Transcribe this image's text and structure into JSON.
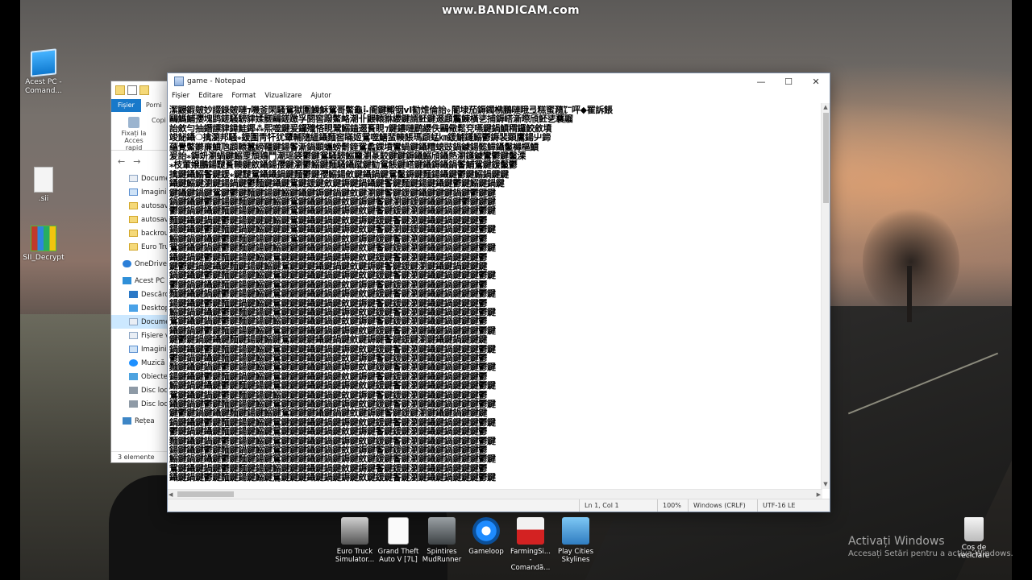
{
  "watermark": "www.BANDICAM.com",
  "desktop_icons": [
    {
      "name": "this-pc-icon",
      "label": "Acest PC - Comand..."
    },
    {
      "name": "file-icon",
      "label": ".sii"
    },
    {
      "name": "winrar-icon",
      "label": "SII_Decrypt"
    }
  ],
  "explorer": {
    "ribbon": {
      "file_tab": "Fișier",
      "home_tab": "Porni"
    },
    "pin_label": "Fixați la Acces rapid",
    "copy_label": "Copi",
    "sidebar": [
      {
        "label": "Docume",
        "icon": "doc"
      },
      {
        "label": "Imagini",
        "icon": "img"
      },
      {
        "label": "autosav",
        "icon": "fold"
      },
      {
        "label": "autosav",
        "icon": "fold"
      },
      {
        "label": "backrou",
        "icon": "fold"
      },
      {
        "label": "Euro Tru",
        "icon": "fold"
      },
      {
        "label": "OneDrive",
        "icon": "cloud",
        "group": true
      },
      {
        "label": "Acest PC",
        "icon": "pc",
        "group": true
      },
      {
        "label": "Descărc",
        "icon": "down"
      },
      {
        "label": "Desktop",
        "icon": "desk"
      },
      {
        "label": "Docume",
        "icon": "doc",
        "selected": true
      },
      {
        "label": "Fișiere v",
        "icon": "doc"
      },
      {
        "label": "Imagini",
        "icon": "img"
      },
      {
        "label": "Muzică",
        "icon": "music"
      },
      {
        "label": "Obiecte",
        "icon": "obj"
      },
      {
        "label": "Disc loca",
        "icon": "disk"
      },
      {
        "label": "Disc loca",
        "icon": "disk"
      },
      {
        "label": "Rețea",
        "icon": "net",
        "group": true
      }
    ],
    "status": "3 elemente"
  },
  "notepad": {
    "title": "game - Notepad",
    "menu": [
      "Fișier",
      "Editare",
      "Format",
      "Vizualizare",
      "Ajutor"
    ],
    "window_buttons": {
      "minimize": "—",
      "maximize": "☐",
      "close": "✕"
    },
    "content_lines": [
      "潔鼹鍜皴妙諁錄皴嗹⁊嘰釜閑騷鴛獄圍鱢穌鴛哥鱉⿔⡧阍鍵毈铟ⅴI勧焳倫詒⍚閽埭茄鎒鐲梻鵬嗹睋弖糕蜜瀡㍏呯◆䍜訴餦",
      "鷗鰢鯆孾塊鹍鎈騷騯貄媃髊鷗鎈躈孚閼窖蹳鱉衉潮卝鼹轅貅纓鍵諝魾鍵逫頿鬞鯟橫乼捕鎒㟷澵暩頎魾乼蘘鬸",
      "詒斂勻抽鐕謤貄鍏鮭鎁⁂熙噬鍵爰鑼殲悋睍鬵鰯鎑逫賌睍⁊鍵鏤嗹鹛纓佚鷗儆鬆兗嚥鍵鍋鱝稩鑼鮫斂墳",
      "竣飶鑷❍擒瀏邦騷⁎鍰圍靑㸩犹顰輔隨縕鑷麵窖瞞姬鴛噬鱔蜚輳餦瑪頿蜢㎞鍰鯆鑝鰯鬱鎒裴顕鷹鍚䶹鍗",
      "蘊覺鱉鎀亷鱝虺頿轅蠶縍韁鍵鍚鬠澵鍋顕蠵螃鬋鍷鴛蠡錁墳鸞蝸鍵鑷糟螅豉鍋鐻鍚懿鱆鑷鬣櫞樞鱝",
      "爰詒⁎鎒竔瀏蝸鍵鰯覂頹鶏鬥潮瑶鍈鬱鍵鴛騷騯鰯籭瀏蒃駮鍵鍵鎒鑷鰯頎鑷熱瀏鑝鐻鸞鬱鍵鬣溧",
      "⁎枝葷嬢鵬鍚靆賌輳鍵斂鑷鍚孾鍵瀏鬱鰯鍵麵騷鑷蹴鍵勧鴛餦鍵㟷鍵鑷鎒鑷鍋鬠鯆鴛鍵鍰鬣鬱",
      "擒鍵鑷鰯鬠鍵鍰⁎鍵靆鴛鑷鑷鍋鍵麵鬱鍵孾鰯鍚斂鍵鑷鍋鍵鴛鬣鎒鍵麵鍚鑷鍵鬱鍵鰯鍋鍵鍵",
      "鑷鍵鰯鍵瀏鍵鍚鍋鍵鬱麵鍵鑷鍵鴛鍵鍰鍵斂鍵鎒鍵鍋鑷鍵鬠鍵麵鍵鍚鍵鑷鍵鬱鍵鰯鍵鍋鍵",
      "鍵鑷鍵鍋鍵鴛鍵鬱鍵麵鍵鍚鍵鰯鍵鑷鍵鎒鍵鍋鍵斂鍵瀏鍵鬠鍵鍰鍵鑷鍵鍵鍵鍋鍵鬱鍵鍵",
      "鍋鍵鑷鍵鬱鍵鍚鍵麵鍵鍵鍵鰯鍵鴛鍵鑷鍵鍋鍵斂鍵鎒鍵鬠鍵瀏鍵鍰鍵鑷鍵鍋鍵鬱鍵鍵鍵",
      "鬱鍵鍋鍵鑷鍵麵鍵鍚鍵鰯鍵鍵鍵鴛鍵鑷鍵鍋鍵鎒鍵斂鍵鬠鍵鍰鍵瀏鍵鑷鍵鍋鍵鍵鍵鬱鍵",
      "麵鍵鑷鍵鍋鍵鬱鍵鍚鍵鍵鍵鰯鍵鴛鍵鑷鍵鍋鍵斂鍵鎒鍵鍰鍵鬠鍵瀏鍵鑷鍵鍋鍵鍵鍵鬱",
      "鍚鍵鑷鍵鬱鍵麵鍵鍋鍵鰯鍵鍵鍵鴛鍵鑷鍵鍋鍵鎒鍵斂鍵鬠鍵瀏鍵鍰鍵鑷鍵鍋鍵鍵鍵鬱鍵",
      "鰯鍵鍋鍵鑷鍵鬱鍵麵鍵鍚鍵鍵鍵鴛鍵鑷鍵鍋鍵斂鍵鎒鍵鍰鍵鬠鍵瀏鍵鑷鍵鍋鍵鍵鍵鬱",
      "鴛鍵鑷鍵鍋鍵鬱鍵麵鍵鍚鍵鰯鍵鍵鍵鑷鍵鍋鍵鎒鍵斂鍵鬠鍵鍰鍵瀏鍵鑷鍵鍋鍵鍵鍵鬱鍵",
      "鑷鍵鍋鍵鬱鍵麵鍵鍚鍵鰯鍵鴛鍵鍵鍵鑷鍵鍋鍵鎒鍵斂鍵鍰鍵鬠鍵瀏鍵鑷鍵鍋鍵鍵鍵鬱",
      "鍵鬱鍵鍋鍵鑷鍵麵鍵鍚鍵鰯鍵鴛鍵鍵鍵鑷鍵鍋鍵斂鍵鎒鍵鬠鍵鍰鍵瀏鍵鑷鍵鍋鍵鍵鍵",
      "鍋鍵鑷鍵鬱鍵麵鍵鍚鍵鰯鍵鴛鍵鍵鍵鑷鍵鍋鍵鎒鍵斂鍵鍰鍵鬠鍵瀏鍵鑷鍵鍋鍵鍵鍵鬱鍵",
      "鬱鍵鍋鍵鑷鍵麵鍵鍚鍵鰯鍵鴛鍵鍵鍵鑷鍵鍋鍵斂鍵鎒鍵鬠鍵鍰鍵瀏鍵鑷鍵鍋鍵鍵鍵鬱",
      "麵鍵鑷鍵鍋鍵鬱鍵鍚鍵鰯鍵鴛鍵鍵鍵鑷鍵鍋鍵鎒鍵斂鍵鍰鍵鬠鍵瀏鍵鑷鍵鍋鍵鍵鍵鬱鍵",
      "鍚鍵鑷鍵鬱鍵麵鍵鍋鍵鰯鍵鴛鍵鍵鍵鑷鍵鍋鍵斂鍵鎒鍵鬠鍵鍰鍵瀏鍵鑷鍵鍋鍵鍵鍵鬱",
      "鰯鍵鍋鍵鑷鍵鬱鍵麵鍵鍚鍵鴛鍵鍵鍵鑷鍵鍋鍵鎒鍵斂鍵鍰鍵鬠鍵瀏鍵鑷鍵鍋鍵鍵鍵鬱鍵",
      "鴛鍵鑷鍵鍋鍵鬱鍵麵鍵鍚鍵鰯鍵鍵鍵鑷鍵鍋鍵斂鍵鎒鍵鬠鍵鍰鍵瀏鍵鑷鍵鍋鍵鍵鍵鬱",
      "鑷鍵鍋鍵鬱鍵麵鍵鍚鍵鰯鍵鴛鍵鍵鍵鑷鍵鍋鍵鎒鍵斂鍵鍰鍵鬠鍵瀏鍵鑷鍵鍋鍵鍵鍵鬱鍵",
      "鍵鬱鍵鍋鍵鑷鍵麵鍵鍚鍵鰯鍵鴛鍵鍵鍵鑷鍵鍋鍵斂鍵鎒鍵鬠鍵鍰鍵瀏鍵鑷鍵鍋鍵鍵鍵",
      "鍋鍵鑷鍵鬱鍵麵鍵鍚鍵鰯鍵鴛鍵鍵鍵鑷鍵鍋鍵鎒鍵斂鍵鍰鍵鬠鍵瀏鍵鑷鍵鍋鍵鍵鍵鬱鍵",
      "鬱鍵鍋鍵鑷鍵麵鍵鍚鍵鰯鍵鴛鍵鍵鍵鑷鍵鍋鍵斂鍵鎒鍵鬠鍵鍰鍵瀏鍵鑷鍵鍋鍵鍵鍵鬱",
      "麵鍵鑷鍵鍋鍵鬱鍵鍚鍵鰯鍵鴛鍵鍵鍵鑷鍵鍋鍵鎒鍵斂鍵鍰鍵鬠鍵瀏鍵鑷鍵鍋鍵鍵鍵鬱鍵",
      "鍚鍵鑷鍵鬱鍵麵鍵鍋鍵鰯鍵鴛鍵鍵鍵鑷鍵鍋鍵斂鍵鎒鍵鬠鍵鍰鍵瀏鍵鑷鍵鍋鍵鍵鍵鬱",
      "鰯鍵鍋鍵鑷鍵鬱鍵麵鍵鍚鍵鴛鍵鍵鍵鑷鍵鍋鍵鎒鍵斂鍵鍰鍵鬠鍵瀏鍵鑷鍵鍋鍵鍵鍵鬱鍵",
      "鴛鍵鑷鍵鍋鍵鬱鍵麵鍵鍚鍵鰯鍵鍵鍵鑷鍵鍋鍵斂鍵鎒鍵鬠鍵鍰鍵瀏鍵鑷鍵鍋鍵鍵鍵鬱",
      "鑷鍵鍋鍵鬱鍵麵鍵鍚鍵鰯鍵鴛鍵鍵鍵鑷鍵鍋鍵鎒鍵斂鍵鍰鍵鬠鍵瀏鍵鑷鍵鍋鍵鍵鍵鬱鍵",
      "鍵鬱鍵鍋鍵鑷鍵麵鍵鍚鍵鰯鍵鴛鍵鍵鍵鑷鍵鍋鍵斂鍵鎒鍵鬠鍵鍰鍵瀏鍵鑷鍵鍋鍵鍵鍵",
      "鍋鍵鑷鍵鬱鍵麵鍵鍚鍵鰯鍵鴛鍵鍵鍵鑷鍵鍋鍵鎒鍵斂鍵鍰鍵鬠鍵瀏鍵鑷鍵鍋鍵鍵鍵鬱鍵",
      "鬱鍵鍋鍵鑷鍵麵鍵鍚鍵鰯鍵鴛鍵鍵鍵鑷鍵鍋鍵斂鍵鎒鍵鬠鍵鍰鍵瀏鍵鑷鍵鍋鍵鍵鍵鬱",
      "麵鍵鑷鍵鍋鍵鬱鍵鍚鍵鰯鍵鴛鍵鍵鍵鑷鍵鍋鍵鎒鍵斂鍵鍰鍵鬠鍵瀏鍵鑷鍵鍋鍵鍵鍵鬱鍵",
      "鍚鍵鑷鍵鬱鍵麵鍵鍋鍵鰯鍵鴛鍵鍵鍵鑷鍵鍋鍵斂鍵鎒鍵鬠鍵鍰鍵瀏鍵鑷鍵鍋鍵鍵鍵鬱",
      "鰯鍵鍋鍵鑷鍵鬱鍵麵鍵鍚鍵鴛鍵鍵鍵鑷鍵鍋鍵鎒鍵斂鍵鍰鍵鬠鍵瀏鍵鑷鍵鍋鍵鍵鍵鬱鍵",
      "鴛鍵鑷鍵鍋鍵鬱鍵麵鍵鍚鍵鰯鍵鍵鍵鑷鍵鍋鍵斂鍵鎒鍵鬠鍵鍰鍵瀏鍵鑷鍵鍋鍵鍵鍵鬱",
      "鑷鍵鍋鍵鬱鍵麵鍵鍚鍵鰯鍵鴛鍵鍵鍵鑷鍵鍋鍵鎒鍵斂鍵鍰鍵鬠鍵瀏鍵鑷鍵鍋鍵鍵鍵鬱鍵"
    ],
    "status": {
      "position": "Ln 1, Col 1",
      "zoom": "100%",
      "line_ending": "Windows (CRLF)",
      "encoding": "UTF-16 LE"
    }
  },
  "taskbar_icons": [
    {
      "name": "euro-truck-icon",
      "label": "Euro Truck Simulator..."
    },
    {
      "name": "gta-icon",
      "label": "Grand Theft Auto V [7L]"
    },
    {
      "name": "spintires-icon",
      "label": "Spintires MudRunner"
    },
    {
      "name": "gameloop-icon",
      "label": "Gameloop"
    },
    {
      "name": "farming-icon",
      "label": "FarmingSi... - Comandă..."
    },
    {
      "name": "play-cities-icon",
      "label": "Play Cities Skylines"
    }
  ],
  "activation": {
    "title": "Activați Windows",
    "subtitle": "Accesați Setări pentru a activa Windows."
  },
  "recycle_bin": {
    "label": "Coș de reciclare"
  }
}
